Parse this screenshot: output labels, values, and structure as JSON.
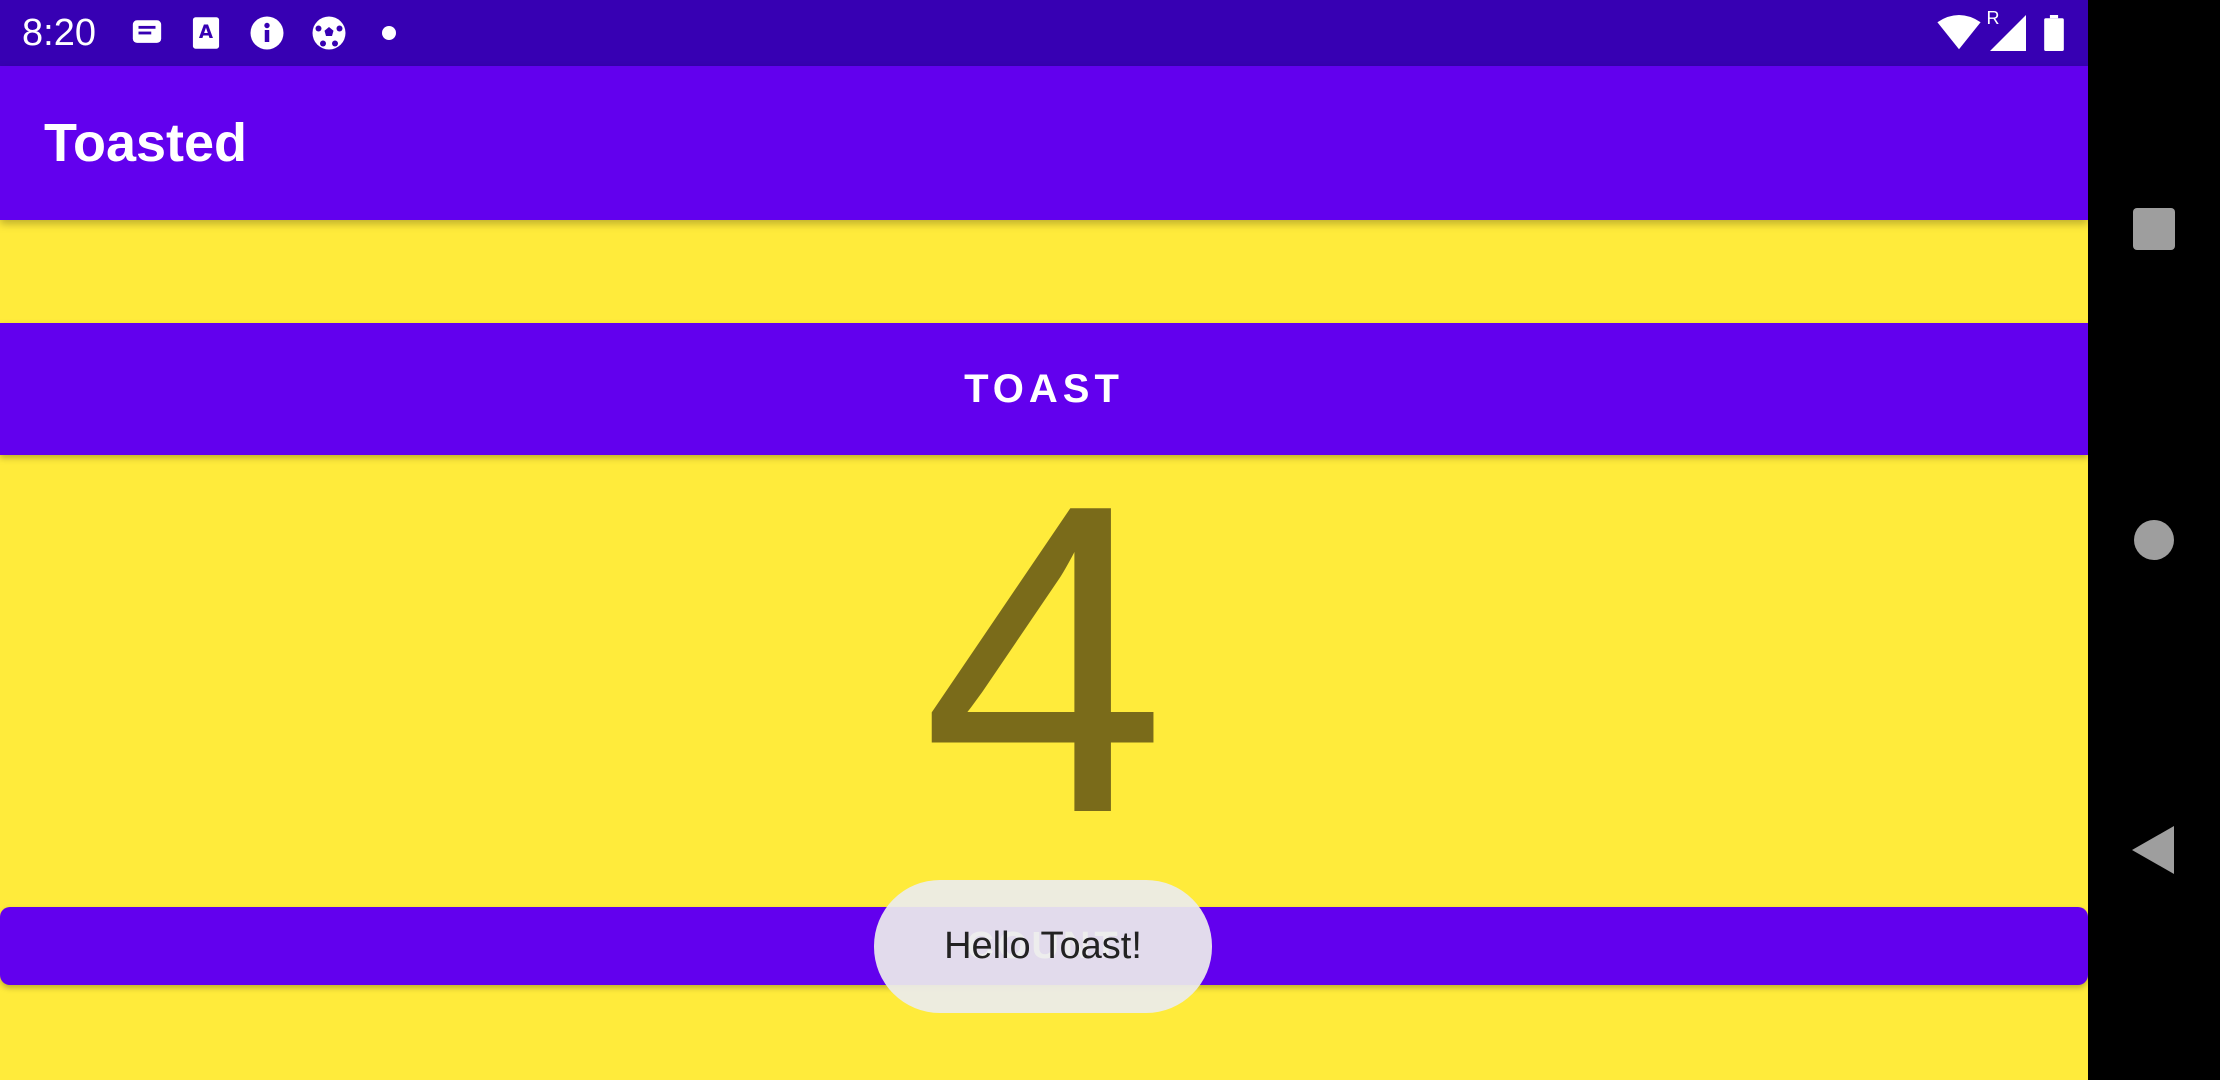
{
  "status_bar": {
    "time": "8:20",
    "notification_icons": [
      "message-icon",
      "a-translate-icon",
      "info-icon",
      "soccer-ball-icon",
      "dot-icon"
    ],
    "right_icons": [
      "wifi-icon",
      "signal-icon",
      "battery-icon"
    ],
    "roaming_indicator": "R"
  },
  "app_bar": {
    "title": "Toasted"
  },
  "main": {
    "toast_button_label": "TOAST",
    "count_value": "4",
    "count_button_label": "COUNT"
  },
  "toast": {
    "message": "Hello Toast!"
  },
  "colors": {
    "status_bar": "#3700B3",
    "primary": "#6200EE",
    "background": "#FFEB3B",
    "count_text": "#7a6b1a"
  },
  "nav_bar": {
    "buttons": [
      "recents-icon",
      "home-icon",
      "back-icon"
    ]
  }
}
